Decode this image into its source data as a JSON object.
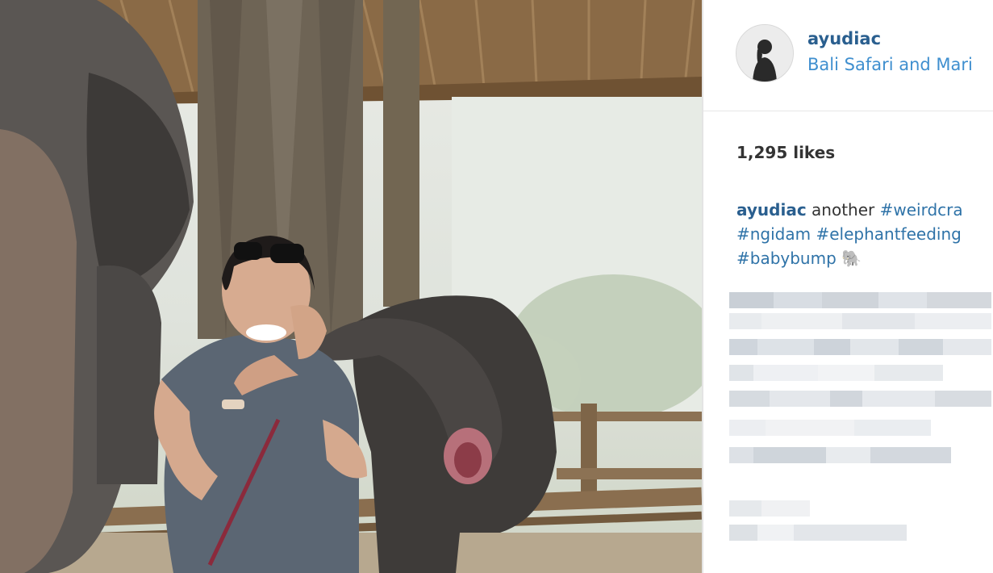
{
  "post": {
    "username": "ayudiac",
    "location": "Bali Safari and Mari",
    "likes": "1,295 likes",
    "caption": {
      "user": "ayudiac",
      "text1": "another ",
      "tag1": "#weirdcra",
      "tag2": "#ngidam",
      "tag3": "#elephantfeeding",
      "tag4": "#babybump",
      "emoji": "🐘"
    }
  },
  "colors": {
    "username": "#2a5f8f",
    "location": "#3f8fcf",
    "hashtag": "#2f73a8"
  },
  "icons": {
    "avatar": "profile-photo",
    "emoji": "elephant-emoji"
  }
}
